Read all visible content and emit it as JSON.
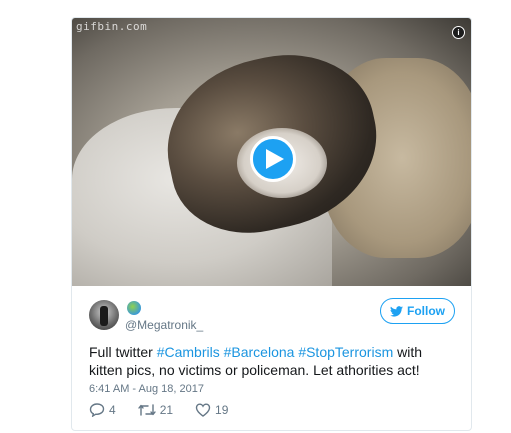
{
  "media": {
    "watermark": "gifbin.com",
    "info_icon": "info-icon",
    "play_icon": "play-icon"
  },
  "user": {
    "handle": "@Megatronik_",
    "badge_icon": "globe-icon"
  },
  "follow_button": {
    "label": "Follow",
    "icon": "twitter-bird-icon"
  },
  "tweet": {
    "segments": [
      {
        "text": "Full twitter ",
        "type": "text"
      },
      {
        "text": "#Cambrils",
        "type": "hashtag"
      },
      {
        "text": " ",
        "type": "text"
      },
      {
        "text": "#Barcelona",
        "type": "hashtag"
      },
      {
        "text": " ",
        "type": "text"
      },
      {
        "text": "#StopTerrorism",
        "type": "hashtag"
      },
      {
        "text": " with kitten pics, no victims or policeman. Let athorities act!",
        "type": "text"
      }
    ],
    "timestamp": "6:41 AM - Aug 18, 2017"
  },
  "actions": {
    "replies": "4",
    "retweets": "21",
    "likes": "19"
  },
  "colors": {
    "accent": "#1da1f2",
    "hashtag": "#1b95e0",
    "muted": "#657786",
    "text": "#14171a",
    "border": "#e1e8ed"
  }
}
